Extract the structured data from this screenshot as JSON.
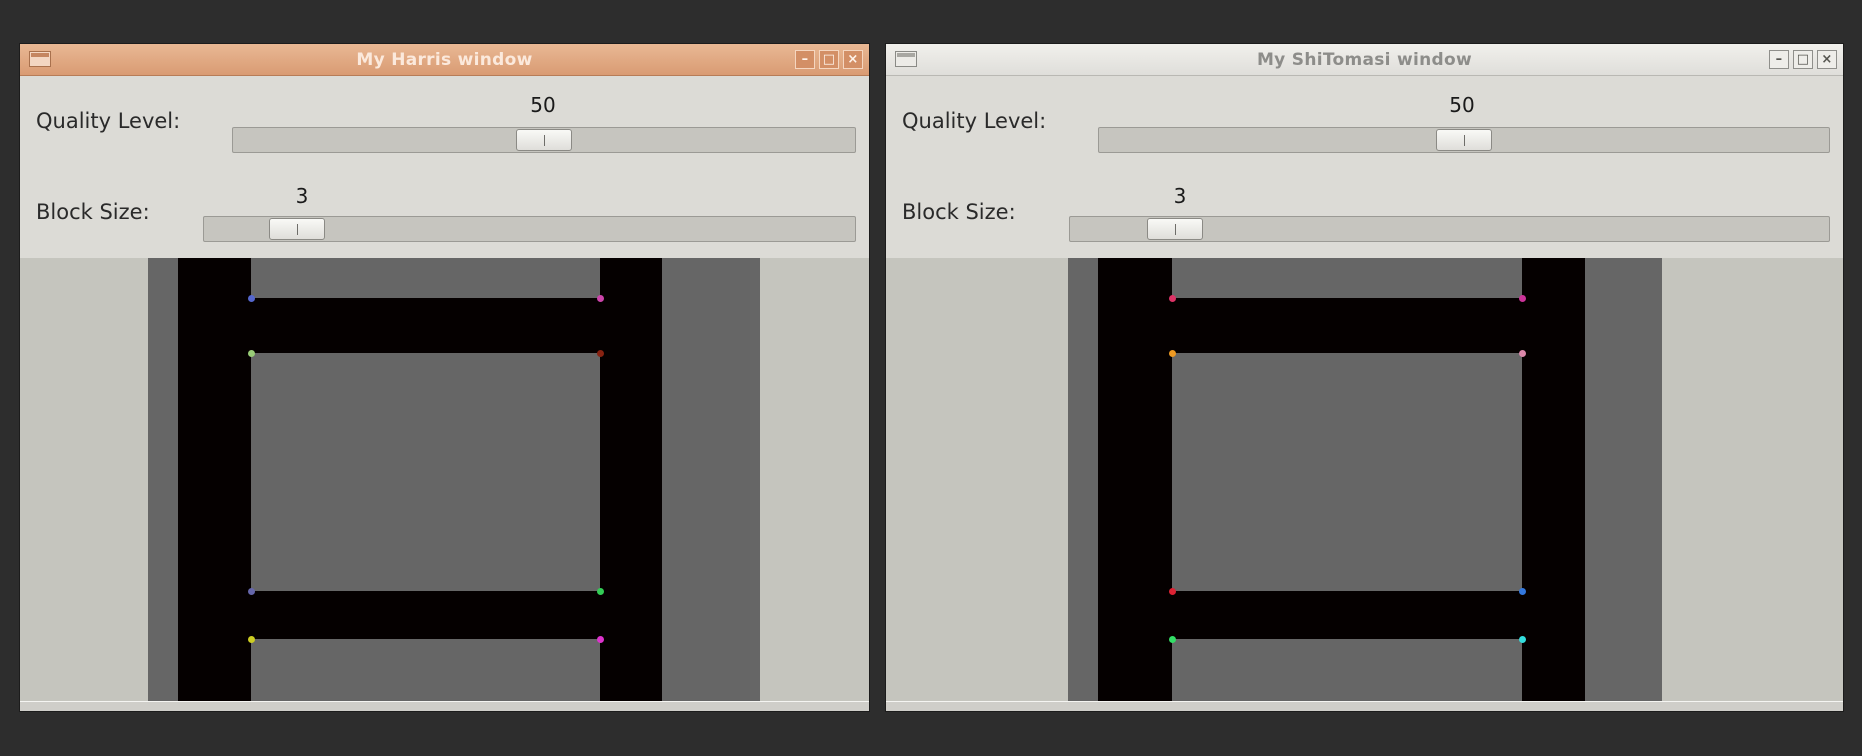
{
  "windows": {
    "harris": {
      "title": "My Harris window",
      "quality_label": "Quality Level:",
      "quality_value": "50",
      "quality_fraction": 0.5,
      "block_label": "Block Size:",
      "block_value": "3",
      "block_fraction": 0.11,
      "corner_colors": [
        "#5566cc",
        "#cc44aa",
        "#99cc77",
        "#882211",
        "#6666aa",
        "#33cc55",
        "#cccc22",
        "#dd33cc"
      ]
    },
    "shitomasi": {
      "title": "My ShiTomasi window",
      "quality_label": "Quality Level:",
      "quality_value": "50",
      "quality_fraction": 0.5,
      "block_label": "Block Size:",
      "block_value": "3",
      "block_fraction": 0.11,
      "corner_colors": [
        "#dd3366",
        "#cc3399",
        "#ee9922",
        "#dd88aa",
        "#dd2233",
        "#3377dd",
        "#33dd66",
        "#33dddd"
      ]
    }
  },
  "icons": {
    "window_menu": "window-menu-icon",
    "minimize": "minimize-icon",
    "maximize": "maximize-icon",
    "close": "close-icon"
  },
  "colors": {
    "active_titlebar": "#dc9f78",
    "inactive_titlebar": "#e6e5e1",
    "window_bg": "#dcdbd6",
    "desktop_bg": "#2d2d2d"
  }
}
